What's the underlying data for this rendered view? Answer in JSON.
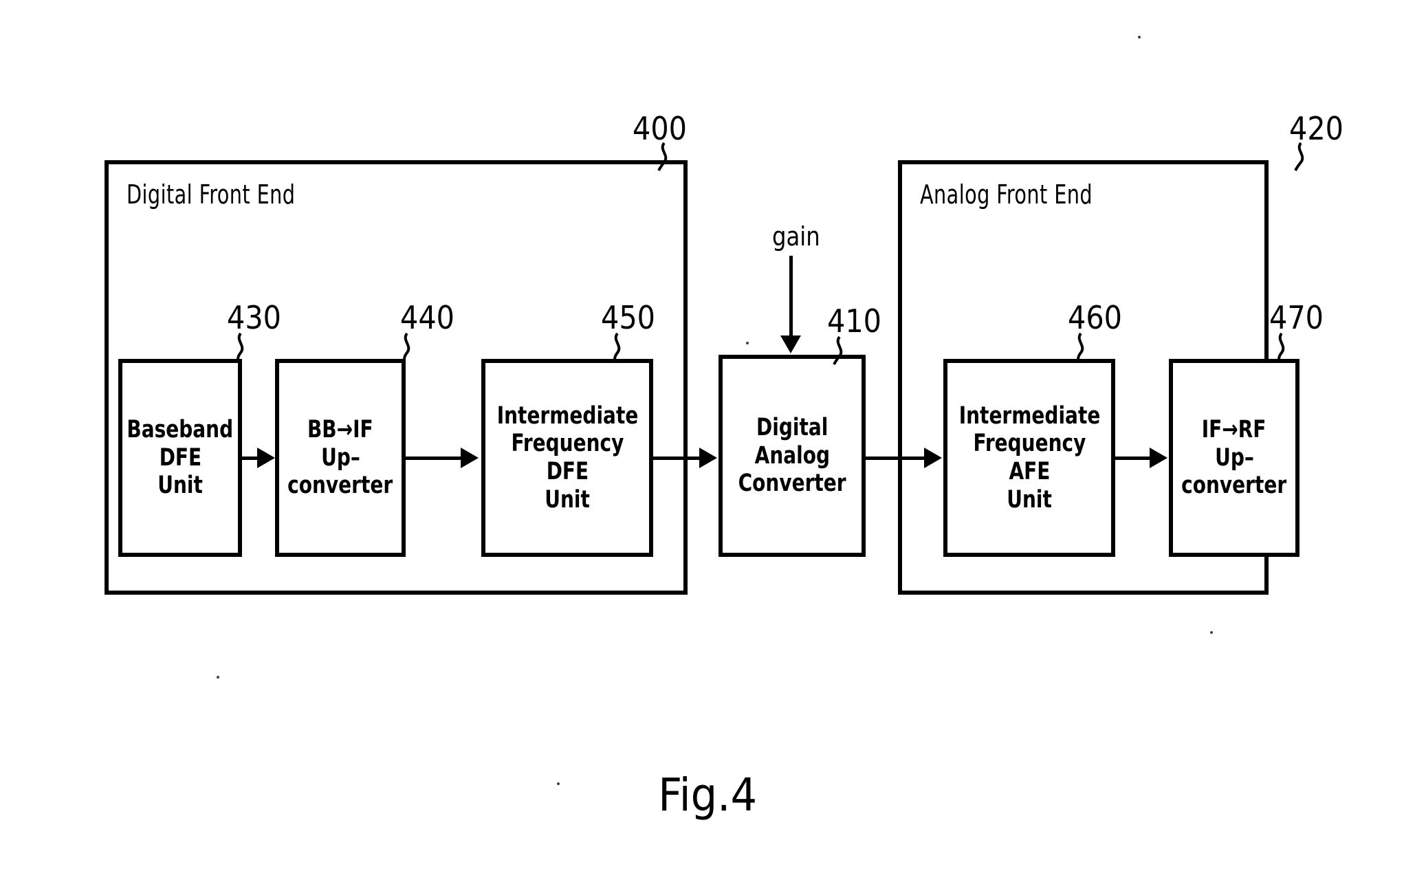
{
  "figure": {
    "caption": "Fig.4",
    "type": "patent-block-diagram"
  },
  "containers": [
    {
      "id": "dfe",
      "title": "Digital Front End",
      "ref": "400"
    },
    {
      "id": "afe",
      "title": "Analog Front End",
      "ref": "420"
    }
  ],
  "blocks": {
    "b430": {
      "ref": "430",
      "lines": [
        "Baseband",
        "DFE",
        "Unit"
      ]
    },
    "b440": {
      "ref": "440",
      "lines": [
        "BB→IF",
        "Up–",
        "converter"
      ]
    },
    "b450": {
      "ref": "450",
      "lines": [
        "Intermediate",
        "Frequency",
        "DFE",
        "Unit"
      ]
    },
    "b410": {
      "ref": "410",
      "lines": [
        "Digital",
        "Analog",
        "Converter"
      ]
    },
    "b460": {
      "ref": "460",
      "lines": [
        "Intermediate",
        "Frequency",
        "AFE",
        "Unit"
      ]
    },
    "b470": {
      "ref": "470",
      "lines": [
        "IF→RF",
        "Up–",
        "converter"
      ]
    }
  },
  "signals": {
    "gain": "gain"
  },
  "colors": {
    "ink": "#000000",
    "paper": "#ffffff"
  }
}
